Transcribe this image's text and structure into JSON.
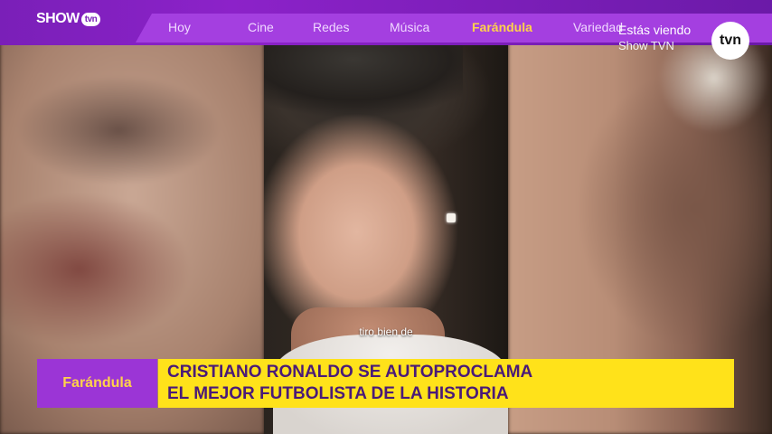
{
  "header": {
    "logo_text": "SHOW",
    "logo_badge": "tvn",
    "nav_items": [
      {
        "label": "Hoy"
      },
      {
        "label": "Cine"
      },
      {
        "label": "Redes"
      },
      {
        "label": "Música"
      },
      {
        "label": "Farándula",
        "active": true
      },
      {
        "label": "Variedad"
      }
    ],
    "now_watching_label": "Estás viendo",
    "now_watching_channel": "Show TVN",
    "channel_logo": "tvn"
  },
  "video": {
    "subtitle": "tiro bien de"
  },
  "lower_third": {
    "category": "Farándula",
    "headline_line1": "CRISTIANO RONALDO SE AUTOPROCLAMA",
    "headline_line2": "EL MEJOR FUTBOLISTA DE LA HISTORIA"
  },
  "colors": {
    "brand_purple": "#7a1fb8",
    "accent_yellow": "#ffe21a",
    "active_nav": "#ffd24a"
  }
}
